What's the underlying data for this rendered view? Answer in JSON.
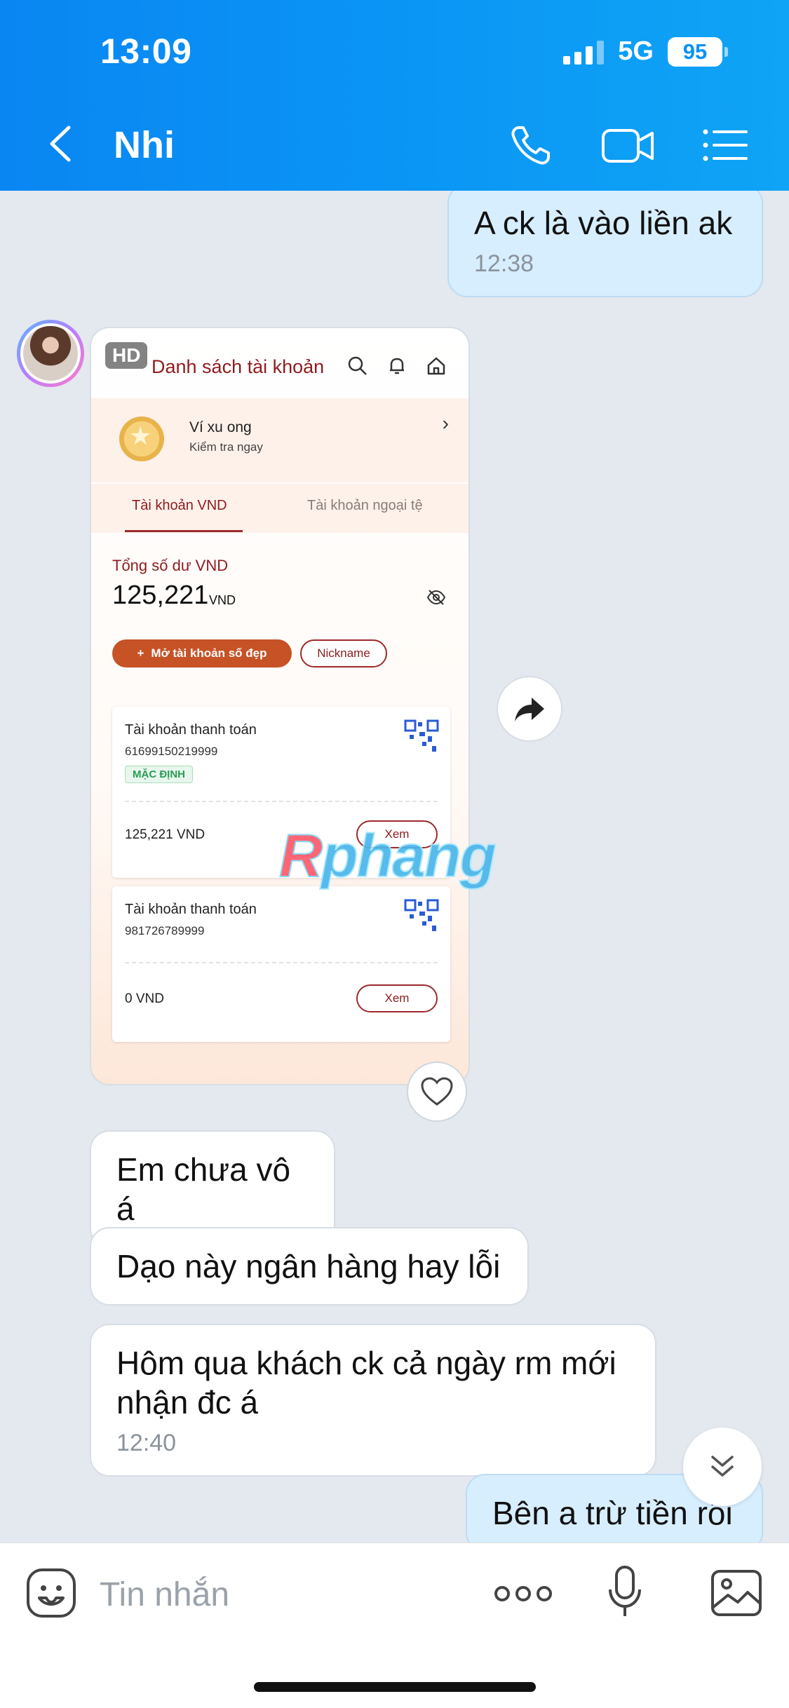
{
  "status_bar": {
    "time": "13:09",
    "network": "5G",
    "battery": "95"
  },
  "header": {
    "contact_name": "Nhi"
  },
  "messages": {
    "m1": {
      "text": "A ck là vào liền ak",
      "time": "12:38"
    },
    "m2": {
      "text": "Em chưa vô á"
    },
    "m3": {
      "text": "Dạo này ngân hàng hay lỗi"
    },
    "m4": {
      "text": "Hôm qua khách ck cả ngày rm mới nhận đc á",
      "time": "12:40"
    },
    "m5": {
      "text": "Bên a trừ tiền rồi"
    }
  },
  "shared_image": {
    "badge": "HD",
    "title": "Danh sách tài khoản",
    "coin": {
      "title": "Ví xu ong",
      "subtitle": "Kiểm tra ngay"
    },
    "tabs": {
      "active": "Tài khoản VND",
      "inactive": "Tài khoản ngoại tệ"
    },
    "balance": {
      "label": "Tổng số dư VND",
      "value": "125,221",
      "unit": "VND"
    },
    "buttons": {
      "open_account": "Mở tài khoản số đẹp",
      "nickname": "Nickname"
    },
    "accounts": [
      {
        "title": "Tài khoản thanh toán",
        "number": "61699150219999",
        "badge": "MẶC ĐỊNH",
        "balance": "125,221 VND",
        "action": "Xem"
      },
      {
        "title": "Tài khoản thanh toán",
        "number": "981726789999",
        "balance": "0 VND",
        "action": "Xem"
      }
    ],
    "watermark": {
      "first": "R",
      "rest": "phang"
    }
  },
  "input": {
    "placeholder": "Tin nhắn"
  },
  "colors": {
    "header": "#0a8ff4",
    "outgoing_bubble": "#d7eefe",
    "incoming_bubble": "#ffffff",
    "bank_red": "#8e1c1f",
    "bank_orange": "#c65226"
  }
}
